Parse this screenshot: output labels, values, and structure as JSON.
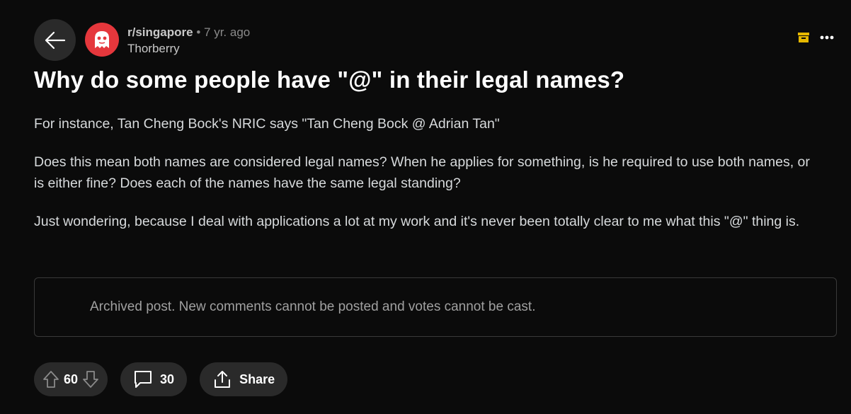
{
  "header": {
    "subreddit": "r/singapore",
    "separator": "•",
    "age": "7 yr. ago",
    "author": "Thorberry"
  },
  "post": {
    "title": "Why do some people have \"@\" in their legal names?",
    "paragraphs": [
      "For instance, Tan Cheng Bock's NRIC says \"Tan Cheng Bock @ Adrian Tan\"",
      "Does this mean both names are considered legal names? When he applies for something, is he required to use both names, or is either fine? Does each of the names have the same legal standing?",
      "Just wondering, because I deal with applications a lot at my work and it's never been totally clear to me what this \"@\" thing is."
    ]
  },
  "archived_notice": "Archived post. New comments cannot be posted and votes cannot be cast.",
  "actions": {
    "votes": "60",
    "comments": "30",
    "share_label": "Share"
  },
  "colors": {
    "avatar_bg": "#e5373c",
    "archive_icon": "#e6b800",
    "background": "#0b0b0b"
  },
  "icons": [
    "back-arrow-icon",
    "subreddit-avatar-icon",
    "archive-icon",
    "more-options-icon",
    "upvote-icon",
    "downvote-icon",
    "comment-icon",
    "share-icon"
  ]
}
